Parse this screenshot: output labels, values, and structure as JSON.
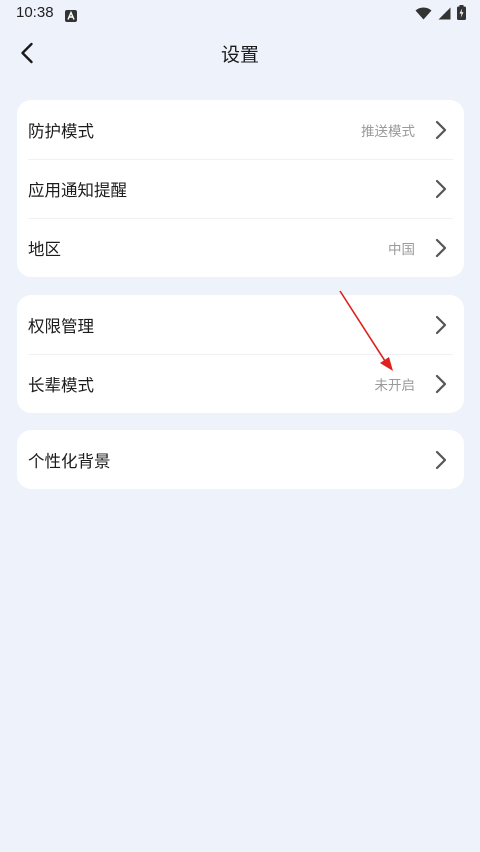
{
  "status_bar": {
    "time": "10:38"
  },
  "header": {
    "title": "设置"
  },
  "cards": [
    {
      "rows": [
        {
          "label": "防护模式",
          "value": "推送模式"
        },
        {
          "label": "应用通知提醒",
          "value": ""
        },
        {
          "label": "地区",
          "value": "中国"
        }
      ]
    },
    {
      "rows": [
        {
          "label": "权限管理",
          "value": ""
        },
        {
          "label": "长辈模式",
          "value": "未开启"
        }
      ]
    },
    {
      "rows": [
        {
          "label": "个性化背景",
          "value": ""
        }
      ]
    }
  ],
  "colors": {
    "background": "#eef2fa",
    "card": "#ffffff",
    "annotation": "#e0201c"
  }
}
